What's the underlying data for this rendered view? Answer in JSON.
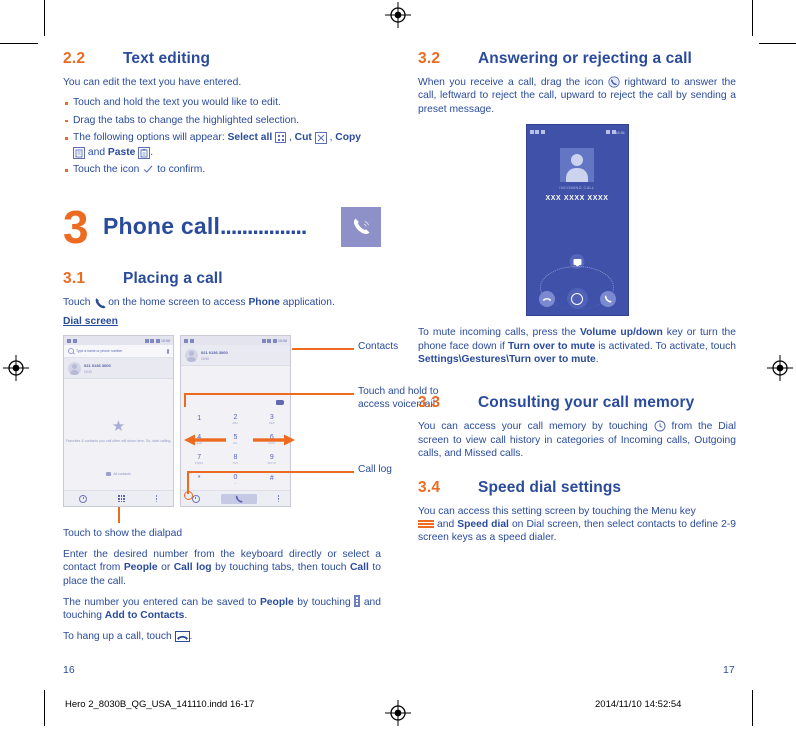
{
  "document": {
    "left_page_number": "16",
    "right_page_number": "17",
    "footer_filename": "Hero 2_8030B_QG_USA_141110.indd   16-17",
    "footer_timestamp": "2014/11/10   14:52:54"
  },
  "colors": {
    "accent_orange": "#ED6B21",
    "heading_blue": "#2a4b9b",
    "phone_ui_blue": "#3f51a8",
    "chapter_icon_bg": "#8e91c8"
  },
  "left": {
    "s22": {
      "number": "2.2",
      "title": "Text editing",
      "intro": "You can edit the text you have entered.",
      "bullets": [
        {
          "text": "Touch and hold the text you would like to edit."
        },
        {
          "text": "Drag the tabs to change the highlighted selection."
        },
        {
          "prefix": "The following options will appear: ",
          "b1": "Select all",
          "sep1": " , ",
          "b2": "Cut",
          "sep2": " , ",
          "b3": "Copy",
          "sep3": " and ",
          "b4": "Paste",
          "suffix": "."
        },
        {
          "prefix": "Touch the icon ",
          "suffix": " to confirm."
        }
      ]
    },
    "chapter": {
      "number": "3",
      "title": "Phone call",
      "dots": "................",
      "icon": "phone-handset-icon"
    },
    "s31": {
      "number": "3.1",
      "title": "Placing a call",
      "line1_pre": "Touch ",
      "line1_mid": " on the home screen to access ",
      "line1_bold": "Phone",
      "line1_post": " application.",
      "subhead": "Dial screen",
      "caption": "Touch to show the dialpad",
      "p1_a": "Enter the desired number from the keyboard directly or select a contact from ",
      "p1_b1": "People",
      "p1_c": " or ",
      "p1_b2": "Call log",
      "p1_d": " by touching tabs, then touch ",
      "p1_b3": "Call",
      "p1_e": " to place the call.",
      "p2_a": "The number you entered can be saved to ",
      "p2_b1": "People",
      "p2_b": " by touching ",
      "p2_c": " and touching ",
      "p2_b2": "Add to Contacts",
      "p2_d": ".",
      "p3_a": "To hang up a call, touch ",
      "p3_b": "."
    },
    "annotations": [
      {
        "label": "Contacts"
      },
      {
        "label": "Touch and hold to access voicemail"
      },
      {
        "label": "Call log"
      }
    ],
    "phone1": {
      "status_time": "15:58",
      "search_placeholder": "Type a name or phone number",
      "contact_number": "021 0136 3000",
      "contact_sub": "15:40",
      "empty_text": "Favorites & contacts you call often will show here. So, start calling.",
      "all_contacts": "All contacts",
      "nav": [
        "call-log-icon",
        "dialpad-icon",
        "overflow-menu-icon"
      ]
    },
    "phone2": {
      "status_time": "15:58",
      "contact_number": "021 0136 3000",
      "contact_sub": "15:58",
      "keys": [
        {
          "n": "1",
          "s": ""
        },
        {
          "n": "2",
          "s": "ABC"
        },
        {
          "n": "3",
          "s": "DEF"
        },
        {
          "n": "4",
          "s": "GHI"
        },
        {
          "n": "5",
          "s": "JKL"
        },
        {
          "n": "6",
          "s": "MNO"
        },
        {
          "n": "7",
          "s": "PQRS"
        },
        {
          "n": "8",
          "s": "TUV"
        },
        {
          "n": "9",
          "s": "WXYZ"
        },
        {
          "n": "*",
          "s": ""
        },
        {
          "n": "0",
          "s": "+"
        },
        {
          "n": "#",
          "s": ""
        }
      ]
    }
  },
  "right": {
    "s32": {
      "number": "3.2",
      "title": "Answering or rejecting a call",
      "p_a": "When you receive a call, drag the icon ",
      "p_b": " rightward to answer the call, leftward to reject the call, upward to reject the call by sending a preset message.",
      "p2_a": "To mute incoming calls, press the ",
      "p2_b1": "Volume up/down",
      "p2_b": " key or turn the phone face down if ",
      "p2_b2": "Turn over to mute",
      "p2_c": " is activated. To activate, touch ",
      "p2_b3": "Settings\\Gestures\\Turn over to mute",
      "p2_d": "."
    },
    "incoming_call": {
      "status_time": "18:36",
      "label": "INCOMING CALL",
      "number": "XXX XXXX XXXX",
      "message_button": "message-reject-icon",
      "reject_button": "end-call-icon",
      "center_button": "drag-handle-icon",
      "answer_button": "answer-call-icon"
    },
    "s33": {
      "number": "3.3",
      "title": "Consulting your call memory",
      "p_a": "You can access your call memory by touching ",
      "p_b": " from the Dial screen to view call history in categories of Incoming calls, Outgoing calls, and Missed calls."
    },
    "s34": {
      "number": "3.4",
      "title": "Speed dial settings",
      "p_a": "You can access this setting screen by touching the Menu key ",
      "p_b": " and ",
      "p_bold": "Speed dial",
      "p_c": " on Dial screen, then select contacts to define 2-9 screen keys as a speed dialer."
    }
  }
}
